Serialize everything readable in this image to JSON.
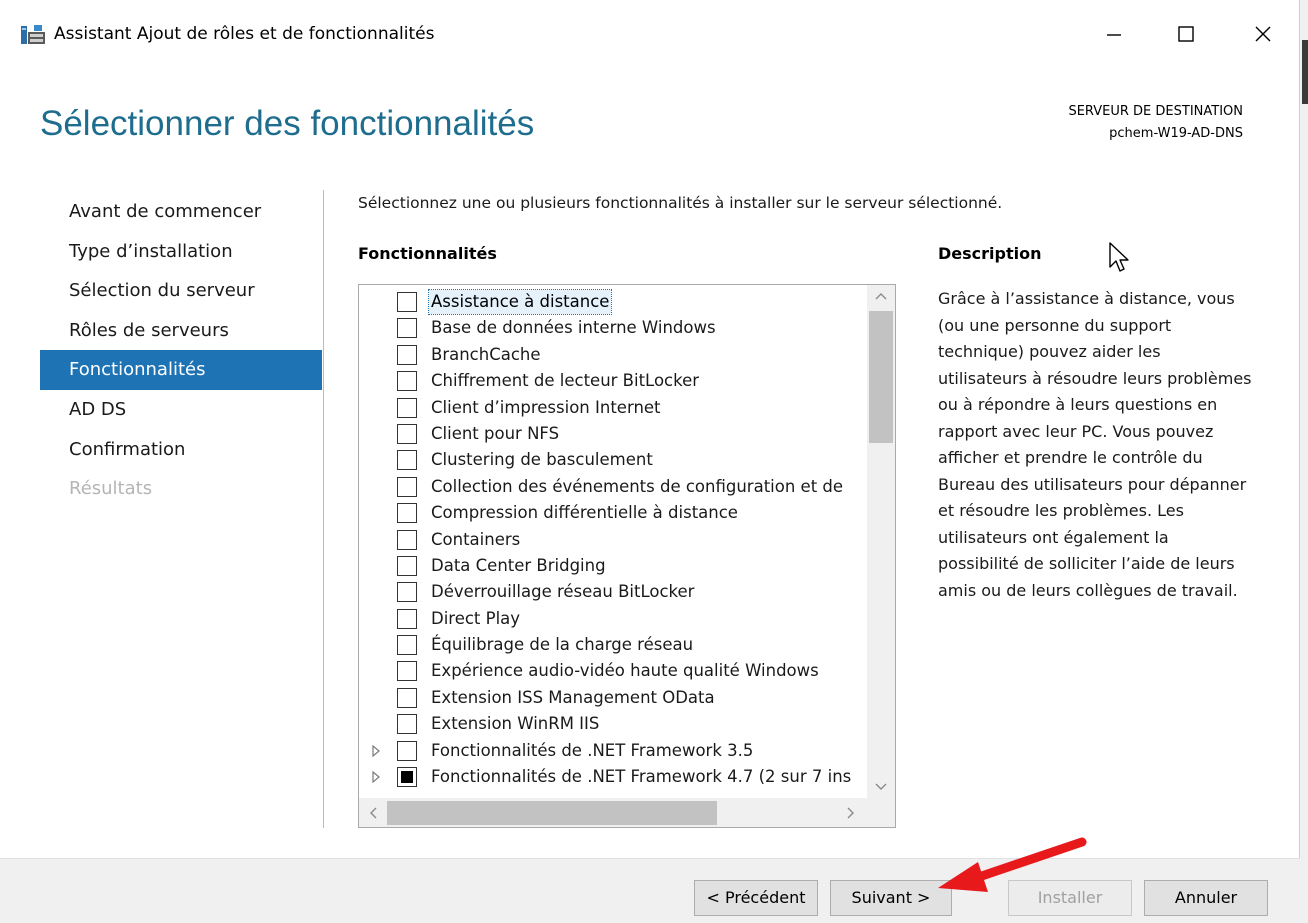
{
  "window": {
    "title": "Assistant Ajout de rôles et de fonctionnalités",
    "icons": {
      "app": "server-manager-icon",
      "minimize": "minimize-icon",
      "maximize": "maximize-icon",
      "close": "close-icon"
    }
  },
  "header": {
    "page_title": "Sélectionner des fonctionnalités",
    "destination_label": "SERVEUR DE DESTINATION",
    "destination_server": "pchem-W19-AD-DNS"
  },
  "nav": {
    "items": [
      {
        "label": "Avant de commencer",
        "state": "normal"
      },
      {
        "label": "Type d’installation",
        "state": "normal"
      },
      {
        "label": "Sélection du serveur",
        "state": "normal"
      },
      {
        "label": "Rôles de serveurs",
        "state": "normal"
      },
      {
        "label": "Fonctionnalités",
        "state": "active"
      },
      {
        "label": "AD DS",
        "state": "normal"
      },
      {
        "label": "Confirmation",
        "state": "normal"
      },
      {
        "label": "Résultats",
        "state": "disabled"
      }
    ]
  },
  "content": {
    "instruction": "Sélectionnez une ou plusieurs fonctionnalités à installer sur le serveur sélectionné.",
    "features_heading": "Fonctionnalités",
    "description_heading": "Description",
    "description_text": "Grâce à l’assistance à distance, vous (ou une personne du support technique) pouvez aider les utilisateurs à résoudre leurs problèmes ou à répondre à leurs questions en rapport avec leur PC. Vous pouvez afficher et prendre le contrôle du Bureau des utilisateurs pour dépanner et résoudre les problèmes. Les utilisateurs ont également la possibilité de solliciter l’aide de leurs amis ou de leurs collègues de travail.",
    "features": [
      {
        "label": "Assistance à distance",
        "checked": false,
        "selected": true,
        "expandable": false
      },
      {
        "label": "Base de données interne Windows",
        "checked": false,
        "selected": false,
        "expandable": false
      },
      {
        "label": "BranchCache",
        "checked": false,
        "selected": false,
        "expandable": false
      },
      {
        "label": "Chiffrement de lecteur BitLocker",
        "checked": false,
        "selected": false,
        "expandable": false
      },
      {
        "label": "Client d’impression Internet",
        "checked": false,
        "selected": false,
        "expandable": false
      },
      {
        "label": "Client pour NFS",
        "checked": false,
        "selected": false,
        "expandable": false
      },
      {
        "label": "Clustering de basculement",
        "checked": false,
        "selected": false,
        "expandable": false
      },
      {
        "label": "Collection des événements de configuration et de",
        "checked": false,
        "selected": false,
        "expandable": false
      },
      {
        "label": "Compression différentielle à distance",
        "checked": false,
        "selected": false,
        "expandable": false
      },
      {
        "label": "Containers",
        "checked": false,
        "selected": false,
        "expandable": false
      },
      {
        "label": "Data Center Bridging",
        "checked": false,
        "selected": false,
        "expandable": false
      },
      {
        "label": "Déverrouillage réseau BitLocker",
        "checked": false,
        "selected": false,
        "expandable": false
      },
      {
        "label": "Direct Play",
        "checked": false,
        "selected": false,
        "expandable": false
      },
      {
        "label": "Équilibrage de la charge réseau",
        "checked": false,
        "selected": false,
        "expandable": false
      },
      {
        "label": "Expérience audio-vidéo haute qualité Windows",
        "checked": false,
        "selected": false,
        "expandable": false
      },
      {
        "label": "Extension ISS Management OData",
        "checked": false,
        "selected": false,
        "expandable": false
      },
      {
        "label": "Extension WinRM IIS",
        "checked": false,
        "selected": false,
        "expandable": false
      },
      {
        "label": "Fonctionnalités de .NET Framework 3.5",
        "checked": false,
        "selected": false,
        "expandable": true
      },
      {
        "label": "Fonctionnalités de .NET Framework 4.7 (2 sur 7 ins",
        "checked": "partial",
        "selected": false,
        "expandable": true
      }
    ]
  },
  "footer": {
    "prev_label": "< Précédent",
    "next_label": "Suivant >",
    "install_label": "Installer",
    "install_enabled": false,
    "cancel_label": "Annuler"
  },
  "annotation": {
    "arrow_color": "#e8191b",
    "arrow_target": "next-button"
  },
  "colors": {
    "title_blue": "#1e6d8e",
    "nav_active": "#1e73b5"
  }
}
